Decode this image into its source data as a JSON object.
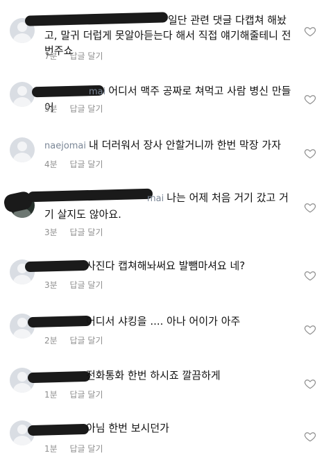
{
  "comments": [
    {
      "handle": "",
      "text": "일단 관련 댓글 다캡쳐 해놨고, 말귀 더럽게 못알아듣는다 해서 직접 얘기해줄테니 전번주쇼",
      "time": "7분",
      "reply": "답글 달기"
    },
    {
      "handle": "mai",
      "text": "어디서 맥주 공짜로 쳐먹고 사람 병신 만들어",
      "time": "5분",
      "reply": "답글 달기"
    },
    {
      "handle": "naejomai",
      "text": "내 더러워서 장사 안할거니까 한번 막장 가자",
      "time": "4분",
      "reply": "답글 달기"
    },
    {
      "handle": "mai",
      "text": "나는 어제 처음 거기 갔고 거기 살지도 않아요.",
      "time": "3분",
      "reply": "답글 달기"
    },
    {
      "handle": "",
      "text": "사진다 캡쳐해놔써요 발뺌마셔요 네?",
      "time": "3분",
      "reply": "답글 달기"
    },
    {
      "handle": "",
      "text": "어디서 샤킹을 .... 아나 어이가 아주",
      "time": "2분",
      "reply": "답글 달기"
    },
    {
      "handle": "",
      "text": "전화통화 한번 하시죠 깔끔하게",
      "time": "1분",
      "reply": "답글 달기"
    },
    {
      "handle": "",
      "text": "아님 한번 보시던가",
      "time": "1분",
      "reply": "답글 달기"
    }
  ],
  "colors": {
    "meta": "#8e8e8e",
    "avatar": "#d9dde3",
    "redaction": "#1a1a1a"
  }
}
